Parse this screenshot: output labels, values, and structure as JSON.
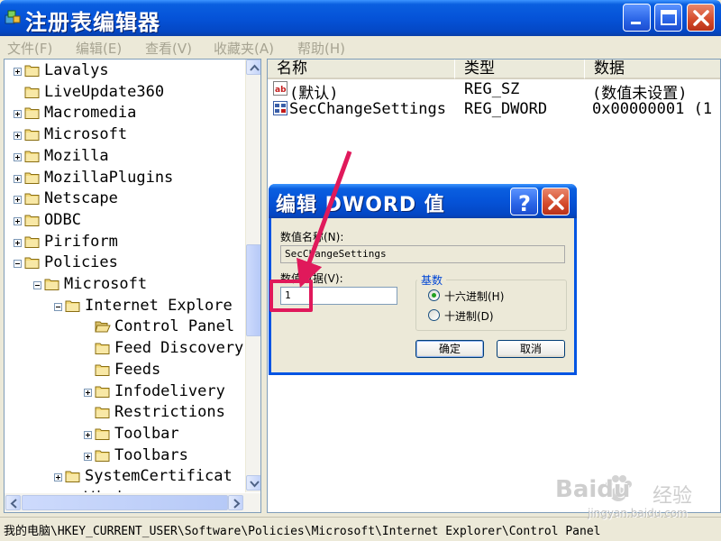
{
  "window": {
    "title": "注册表编辑器",
    "controls": [
      "minimize-button",
      "maximize-button",
      "close-button"
    ]
  },
  "menu": [
    "文件(F)",
    "编辑(E)",
    "查看(V)",
    "收藏夹(A)",
    "帮助(H)"
  ],
  "tree": {
    "items": [
      {
        "label": "Lavalys",
        "depth": 0,
        "expander": "plus",
        "icon": "folder-icon"
      },
      {
        "label": "LiveUpdate360",
        "depth": 0,
        "expander": "none",
        "icon": "folder-icon"
      },
      {
        "label": "Macromedia",
        "depth": 0,
        "expander": "plus",
        "icon": "folder-icon"
      },
      {
        "label": "Microsoft",
        "depth": 0,
        "expander": "plus",
        "icon": "folder-icon"
      },
      {
        "label": "Mozilla",
        "depth": 0,
        "expander": "plus",
        "icon": "folder-icon"
      },
      {
        "label": "MozillaPlugins",
        "depth": 0,
        "expander": "plus",
        "icon": "folder-icon"
      },
      {
        "label": "Netscape",
        "depth": 0,
        "expander": "plus",
        "icon": "folder-icon"
      },
      {
        "label": "ODBC",
        "depth": 0,
        "expander": "plus",
        "icon": "folder-icon"
      },
      {
        "label": "Piriform",
        "depth": 0,
        "expander": "plus",
        "icon": "folder-icon"
      },
      {
        "label": "Policies",
        "depth": 0,
        "expander": "minus",
        "icon": "folder-icon"
      },
      {
        "label": "Microsoft",
        "depth": 1,
        "expander": "minus",
        "icon": "folder-icon"
      },
      {
        "label": "Internet Explore",
        "depth": 2,
        "expander": "minus",
        "icon": "folder-icon"
      },
      {
        "label": "Control Panel",
        "depth": 3,
        "expander": "none",
        "icon": "open-folder-icon"
      },
      {
        "label": "Feed Discovery",
        "depth": 3,
        "expander": "none",
        "icon": "folder-icon"
      },
      {
        "label": "Feeds",
        "depth": 3,
        "expander": "none",
        "icon": "folder-icon"
      },
      {
        "label": "Infodelivery",
        "depth": 3,
        "expander": "plus",
        "icon": "folder-icon"
      },
      {
        "label": "Restrictions",
        "depth": 3,
        "expander": "none",
        "icon": "folder-icon"
      },
      {
        "label": "Toolbar",
        "depth": 3,
        "expander": "plus",
        "icon": "folder-icon"
      },
      {
        "label": "Toolbars",
        "depth": 3,
        "expander": "plus",
        "icon": "folder-icon"
      },
      {
        "label": "SystemCertificat",
        "depth": 2,
        "expander": "plus",
        "icon": "folder-icon"
      },
      {
        "label": "Wind",
        "depth": 2,
        "expander": "plus",
        "icon": "folder-icon"
      }
    ]
  },
  "list": {
    "columns": [
      "名称",
      "类型",
      "数据"
    ],
    "rows": [
      {
        "name": "(默认)",
        "type": "REG_SZ",
        "data": "(数值未设置)",
        "icon": "string-value-icon"
      },
      {
        "name": "SecChangeSettings",
        "type": "REG_DWORD",
        "data": "0x00000001 (1",
        "icon": "dword-value-icon"
      }
    ]
  },
  "status": {
    "path": "我的电脑\\HKEY_CURRENT_USER\\Software\\Policies\\Microsoft\\Internet Explorer\\Control Panel"
  },
  "dialog": {
    "title": "编辑 DWORD 值",
    "value_name_label": "数值名称(N):",
    "value_name": "SecChangeSettings",
    "value_data_label": "数值数据(V):",
    "value_data": "1",
    "base_label": "基数",
    "radio_hex": "十六进制(H)",
    "radio_dec": "十进制(D)",
    "selected_base": "hex",
    "ok": "确定",
    "cancel": "取消"
  },
  "annotation": {
    "arrow_color": "#e0195b"
  },
  "watermark": {
    "brand": "Baidu",
    "suffix": "经验",
    "url": "jingyan.baidu.com"
  }
}
